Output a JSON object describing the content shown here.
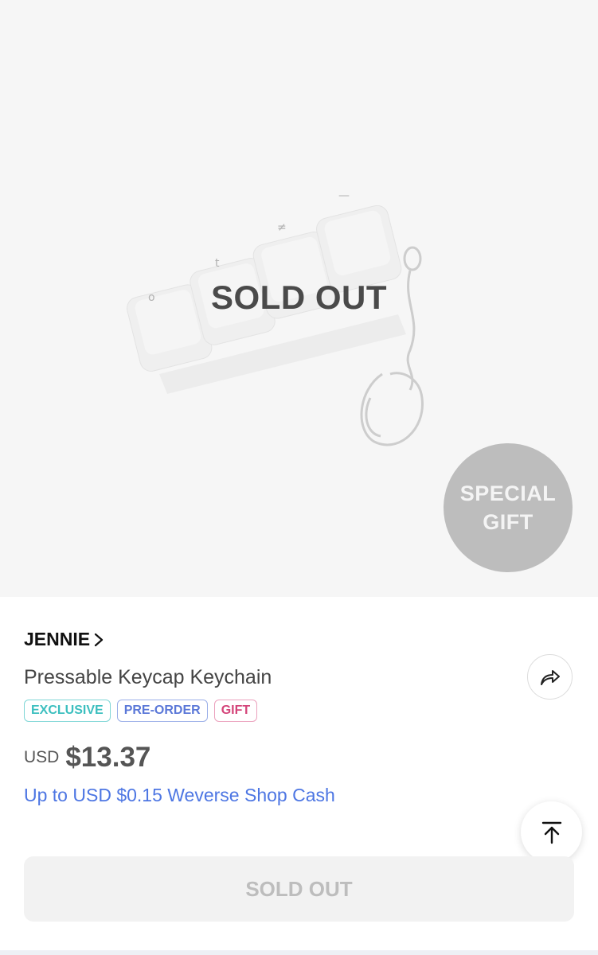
{
  "hero": {
    "overlay_label": "SOLD OUT",
    "badge_line1": "SPECIAL",
    "badge_line2": "GIFT",
    "keycap_glyphs": [
      "o",
      "t",
      "≠",
      "—"
    ]
  },
  "product": {
    "artist": "JENNIE",
    "title": "Pressable Keycap Keychain",
    "tags": [
      "EXCLUSIVE",
      "PRE-ORDER",
      "GIFT"
    ],
    "currency": "USD",
    "price": "$13.37",
    "cash_text": "Up to USD $0.15 Weverse Shop Cash"
  },
  "actions": {
    "soldout_button": "SOLD OUT"
  },
  "colors": {
    "cash_blue": "#4d76e3",
    "exclusive_teal": "#3cbfbf",
    "preorder_blue": "#5b78d8",
    "gift_pink": "#d4457a"
  }
}
